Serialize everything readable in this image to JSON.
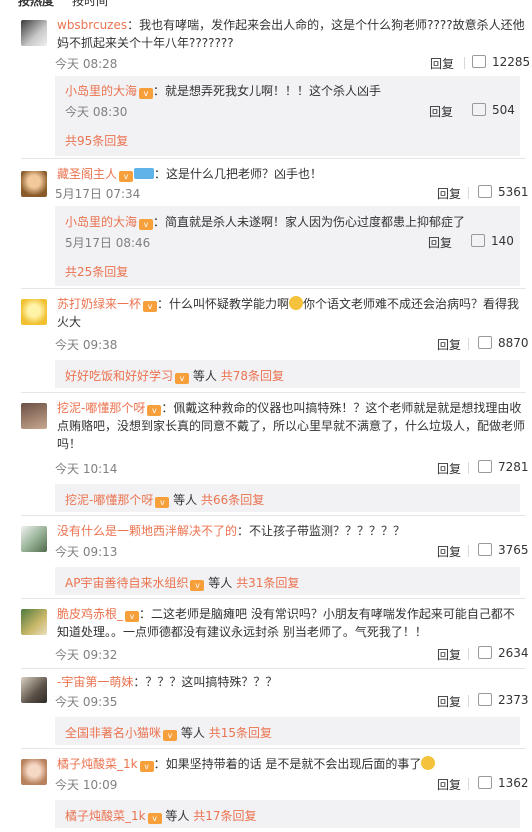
{
  "tabs": {
    "hot": "按热度",
    "time": "按时间"
  },
  "labels": {
    "reply": "回复",
    "and_others": "等人"
  },
  "comments": [
    {
      "user": "wbsbrcuzes",
      "text": "：我也有哮喘，发作起来会出人命的，这是个什么狗老师????故意杀人还他妈不抓起来关个十年八年???????",
      "time": "今天 08:28",
      "likes": "12285",
      "sub": {
        "user": "小岛里的大海",
        "text": "：就是想弄死我女儿啊！！！这个杀人凶手",
        "time": "今天 08:30",
        "likes": "504"
      },
      "more": "共95条回复"
    },
    {
      "user": "藏圣阁主人",
      "text": "：这是什么几把老师？凶手也！",
      "time": "5月17日 07:34",
      "likes": "5361",
      "sub": {
        "user": "小岛里的大海",
        "text": "：简直就是杀人未遂啊！家人因为伤心过度都患上抑郁症了",
        "time": "5月17日 08:46",
        "likes": "140"
      },
      "more": "共25条回复"
    },
    {
      "user": "苏打奶绿来一杯",
      "text1": "：什么叫怀疑教学能力啊",
      "text2": "你个语文老师难不成还会治病吗？看得我火大",
      "time": "今天 09:38",
      "likes": "8870",
      "moreuser": "好好吃饭和好好学习",
      "more": "共78条回复"
    },
    {
      "user": "挖泥-嘟懂那个呀",
      "text": "：佩戴这种救命的仪器也叫搞特殊！？这个老师就是就是想找理由收点贿赂吧，没想到家长真的同意不戴了，所以心里早就不满意了，什么垃圾人，配做老师吗！",
      "time": "今天 10:14",
      "likes": "7281",
      "moreuser": "挖泥-嘟懂那个呀",
      "more": "共66条回复"
    },
    {
      "user": "没有什么是一颗地西泮解决不了的",
      "text": "：不让孩子带监测？？？？？？",
      "time": "今天 09:13",
      "likes": "3765",
      "moreuser": "AP宇宙善待自来水组织",
      "more": "共31条回复"
    },
    {
      "user": "脆皮鸡赤根_",
      "text": "：二这老师是脑瘫吧 没有常识吗？小朋友有哮喘发作起来可能自己都不知道处理。。一点师德都没有建议永远封杀 别当老师了。气死我了！！",
      "time": "今天 09:32",
      "likes": "2634"
    },
    {
      "user": "-宇宙第一萌妹",
      "text": "：？？？这叫搞特殊？？？",
      "time": "今天 09:35",
      "likes": "2373",
      "moreuser": "全国非著名小猫咪",
      "more": "共15条回复"
    },
    {
      "user": "橘子炖酸菜_1k",
      "text": "：如果坚持带着的话 是不是就不会出现后面的事了",
      "time": "今天 10:09",
      "likes": "1362",
      "moreuser": "橘子炖酸菜_1k",
      "more": "共17条回复"
    }
  ]
}
